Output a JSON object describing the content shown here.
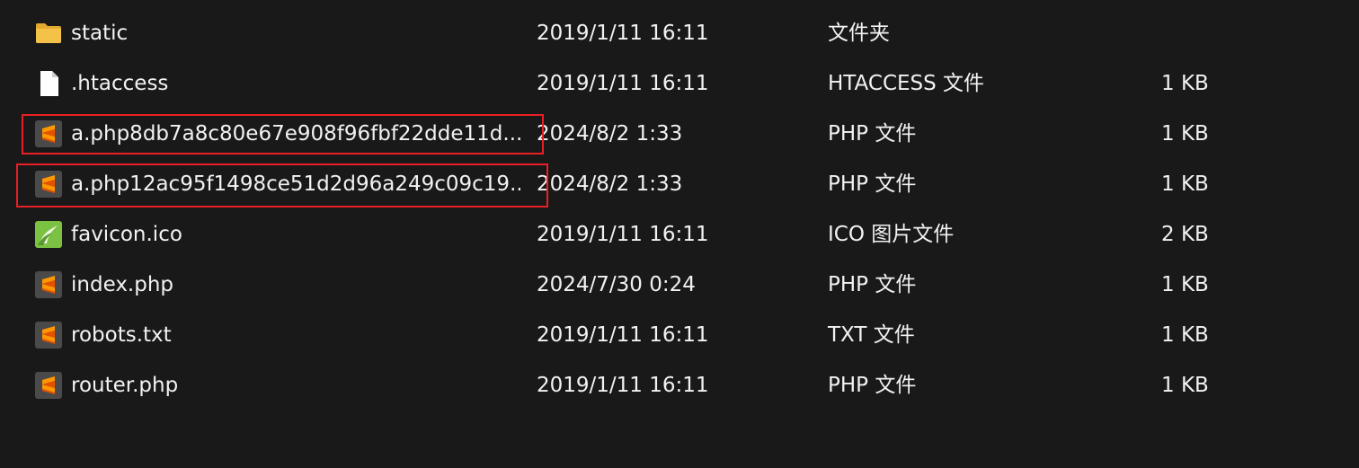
{
  "files": [
    {
      "name": "static",
      "date": "2019/1/11 16:11",
      "type": "文件夹",
      "size": "",
      "icon": "folder-icon"
    },
    {
      "name": ".htaccess",
      "date": "2019/1/11 16:11",
      "type": "HTACCESS 文件",
      "size": "1 KB",
      "icon": "blank-file-icon"
    },
    {
      "name": "a.php8db7a8c80e67e908f96fbf22dde11d...",
      "date": "2024/8/2 1:33",
      "type": "PHP 文件",
      "size": "1 KB",
      "icon": "sublime-text-icon",
      "highlighted": true
    },
    {
      "name": "a.php12ac95f1498ce51d2d96a249c09c19...",
      "date": "2024/8/2 1:33",
      "type": "PHP 文件",
      "size": "1 KB",
      "icon": "sublime-text-icon",
      "highlighted": true
    },
    {
      "name": "favicon.ico",
      "date": "2019/1/11 16:11",
      "type": "ICO 图片文件",
      "size": "2 KB",
      "icon": "favicon-image-icon"
    },
    {
      "name": "index.php",
      "date": "2024/7/30 0:24",
      "type": "PHP 文件",
      "size": "1 KB",
      "icon": "sublime-text-icon"
    },
    {
      "name": "robots.txt",
      "date": "2019/1/11 16:11",
      "type": "TXT 文件",
      "size": "1 KB",
      "icon": "sublime-text-icon"
    },
    {
      "name": "router.php",
      "date": "2019/1/11 16:11",
      "type": "PHP 文件",
      "size": "1 KB",
      "icon": "sublime-text-icon"
    }
  ],
  "colors": {
    "background": "#191919",
    "text": "#f2f2f2",
    "highlight": "#e81f25",
    "folder": "#f4c249",
    "sublime_orange": "#ff9800",
    "sublime_bg": "#4a4a4a",
    "favicon_green": "#7cc242"
  }
}
